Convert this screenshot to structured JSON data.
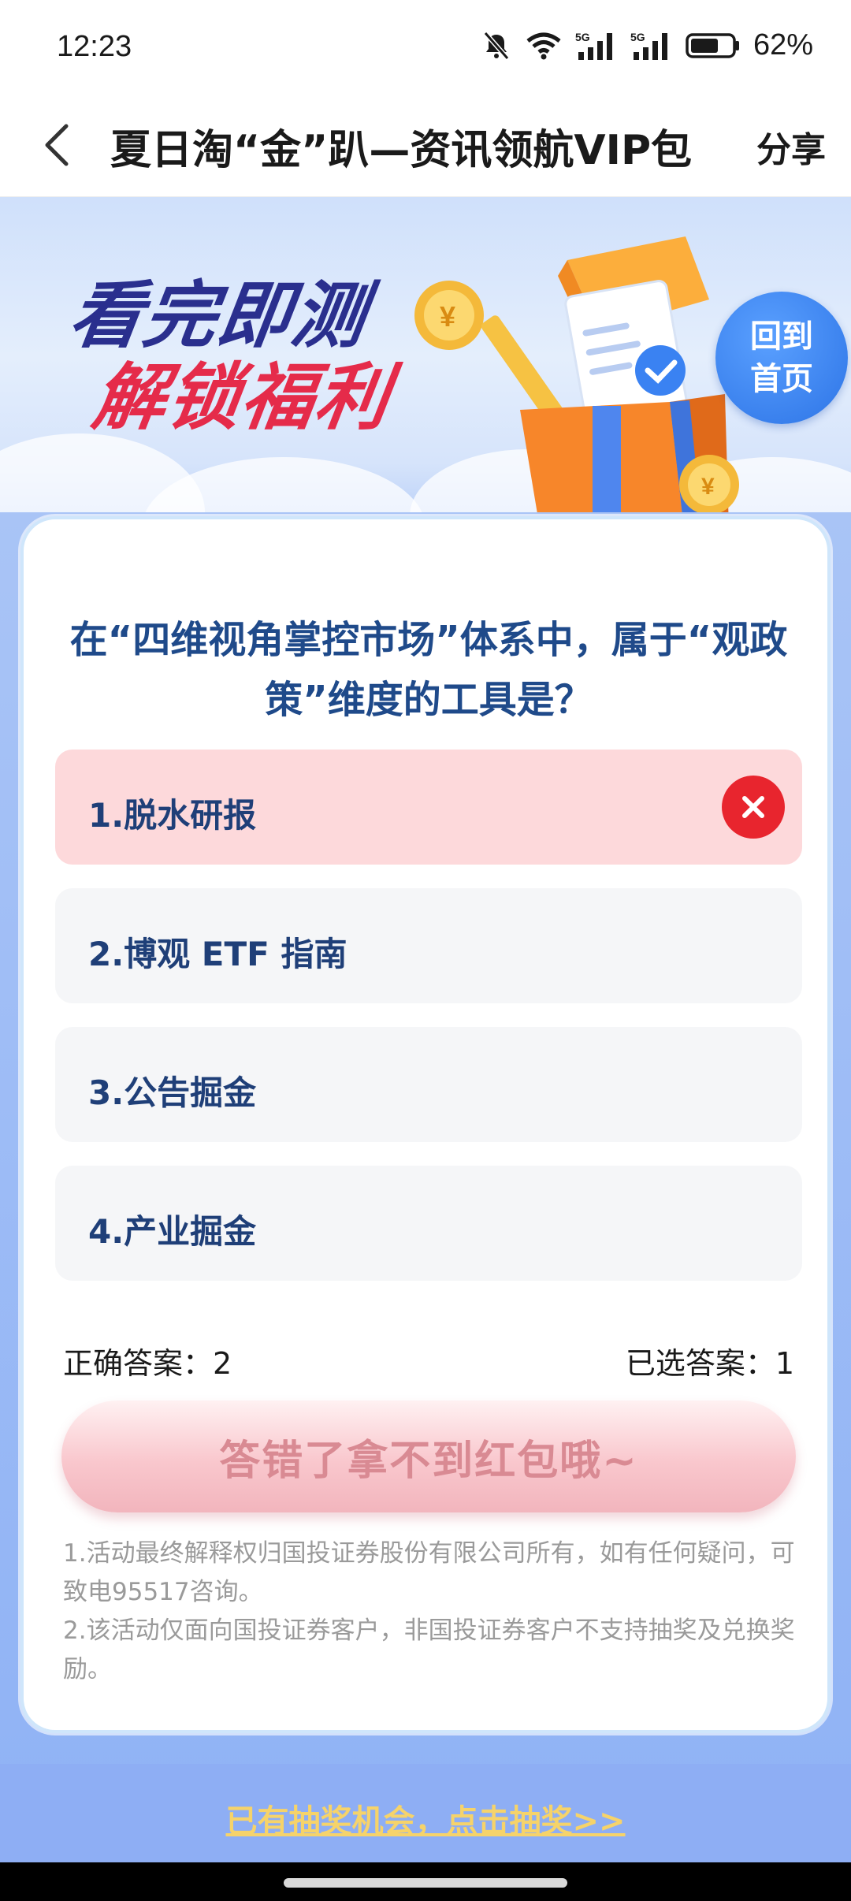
{
  "status_bar": {
    "time": "12:23",
    "battery": "62%",
    "icons": [
      "mute-bell-icon",
      "wifi-icon",
      "5g-signal-icon",
      "5g-signal-icon",
      "battery-icon"
    ]
  },
  "nav": {
    "title": "夏日淘“金”趴—资讯领航VIP包",
    "share": "分享"
  },
  "banner": {
    "line1": "看完即测",
    "line2": "解锁福利",
    "home_button_line1": "回到",
    "home_button_line2": "首页"
  },
  "quiz": {
    "question": "在“四维视角掌控市场”体系中，属于“观政策”维度的工具是？",
    "options": [
      {
        "label": "1.脱水研报",
        "state": "wrong-selected"
      },
      {
        "label": "2.博观 ETF 指南",
        "state": "normal"
      },
      {
        "label": "3.公告掘金",
        "state": "normal"
      },
      {
        "label": "4.产业掘金",
        "state": "normal"
      }
    ],
    "correct_answer_text": "正确答案：2",
    "selected_answer_text": "已选答案：1",
    "result_button": "答错了拿不到红包哦~"
  },
  "rules": {
    "rule1": "1.活动最终解释权归国投证券股份有限公司所有，如有任何疑问，可致电95517咨询。",
    "rule2": "2.该活动仅面向国投证券客户，非国投证券客户不支持抽奖及兑换奖励。"
  },
  "footer": {
    "lottery_link": "已有抽奖机会，点击抽奖>>"
  },
  "colors": {
    "question_text": "#1f4a8a",
    "wrong_option_bg": "#fdd9db",
    "wrong_mark": "#e8252e",
    "lottery_link": "#f6d36a",
    "page_bg_blue": "#8fb2f5"
  }
}
